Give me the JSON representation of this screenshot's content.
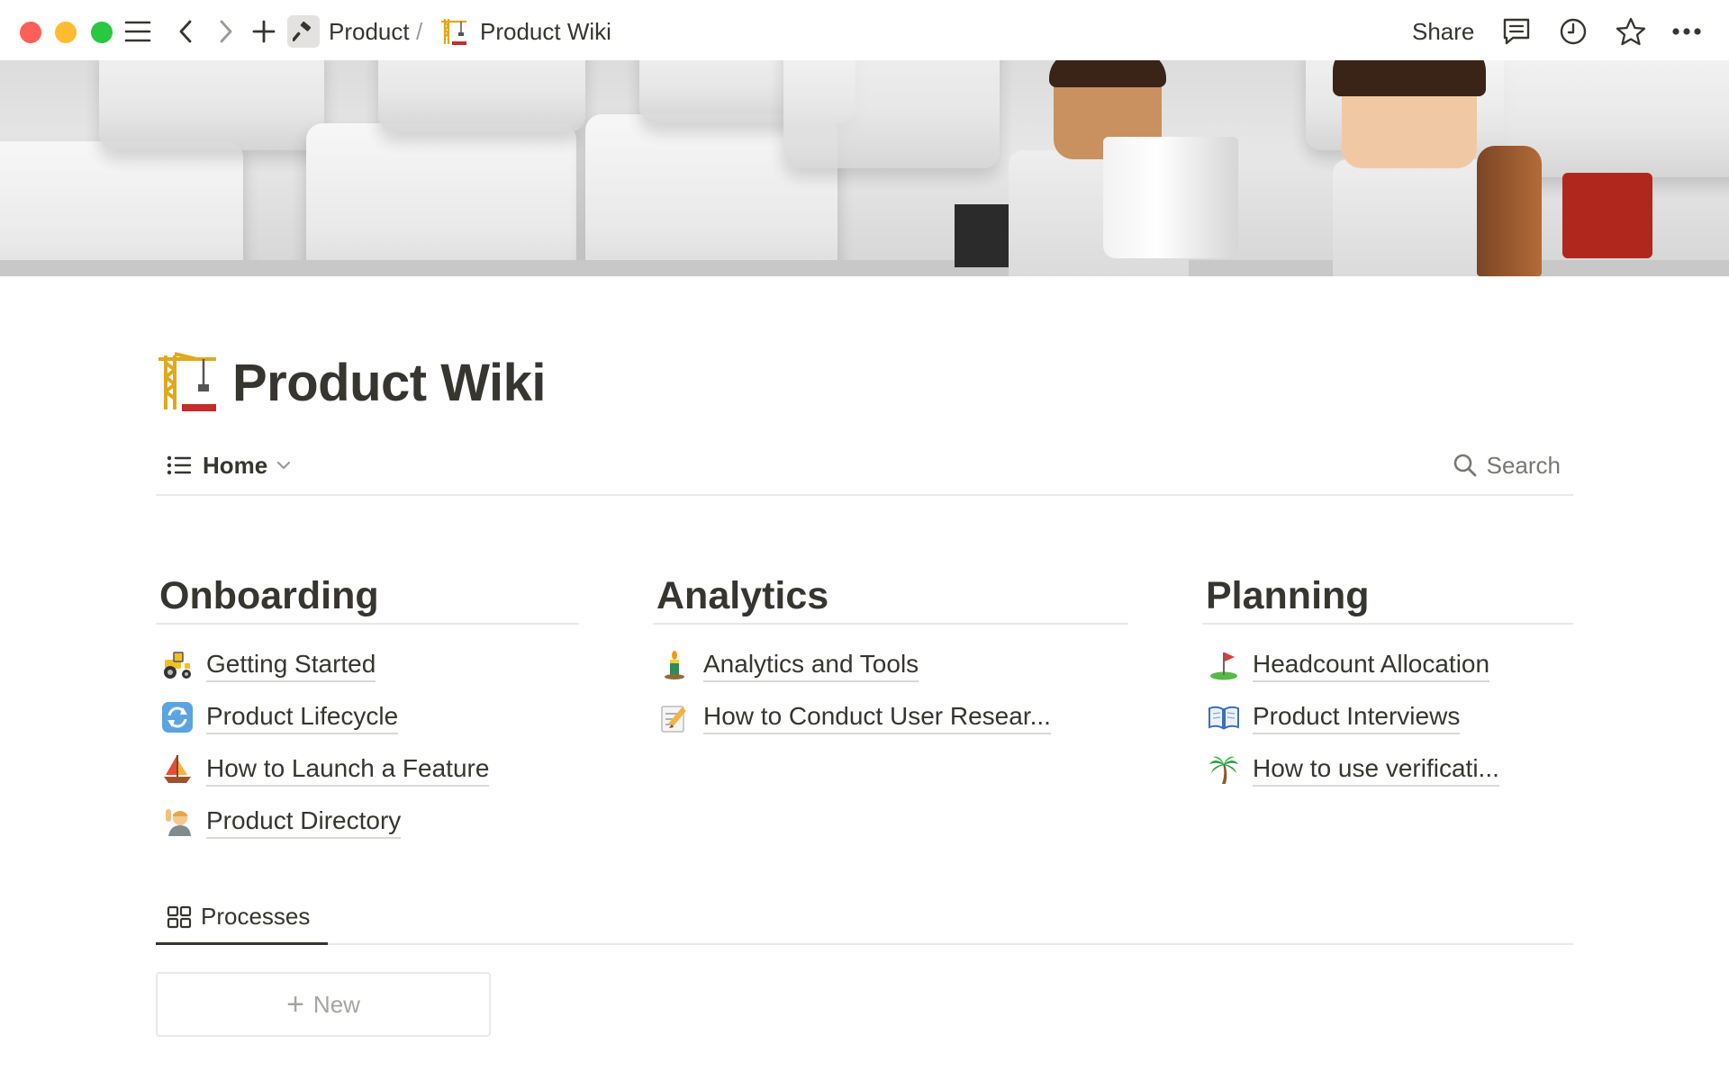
{
  "breadcrumb": {
    "parent_label": "Product",
    "separator": "/",
    "current_label": "Product Wiki"
  },
  "topbar": {
    "share_label": "Share"
  },
  "page": {
    "title": "Product Wiki",
    "title_icon": "construction-crane-icon"
  },
  "view": {
    "tab_label": "Home",
    "search_label": "Search"
  },
  "columns": [
    {
      "title": "Onboarding",
      "items": [
        {
          "label": "Getting Started",
          "icon": "tractor-icon"
        },
        {
          "label": "Product Lifecycle",
          "icon": "cycle-arrows-icon"
        },
        {
          "label": "How to Launch a Feature",
          "icon": "sailboat-icon"
        },
        {
          "label": "Product Directory",
          "icon": "person-raising-hand-icon"
        }
      ]
    },
    {
      "title": "Analytics",
      "items": [
        {
          "label": "Analytics and Tools",
          "icon": "candle-icon"
        },
        {
          "label": "How to Conduct User Resear...",
          "icon": "memo-pencil-icon"
        }
      ]
    },
    {
      "title": "Planning",
      "items": [
        {
          "label": "Headcount Allocation",
          "icon": "golf-flag-icon"
        },
        {
          "label": "Product Interviews",
          "icon": "open-book-icon"
        },
        {
          "label": "How to use verificati...",
          "icon": "palm-tree-icon"
        }
      ]
    }
  ],
  "tabs": {
    "processes_label": "Processes"
  },
  "new_card": {
    "label": "New"
  },
  "colors": {
    "text": "#37352f",
    "muted": "#787774",
    "divider": "#e9e9e7",
    "traffic_red": "#ff5f57",
    "traffic_yellow": "#febc2e",
    "traffic_green": "#28c840"
  }
}
